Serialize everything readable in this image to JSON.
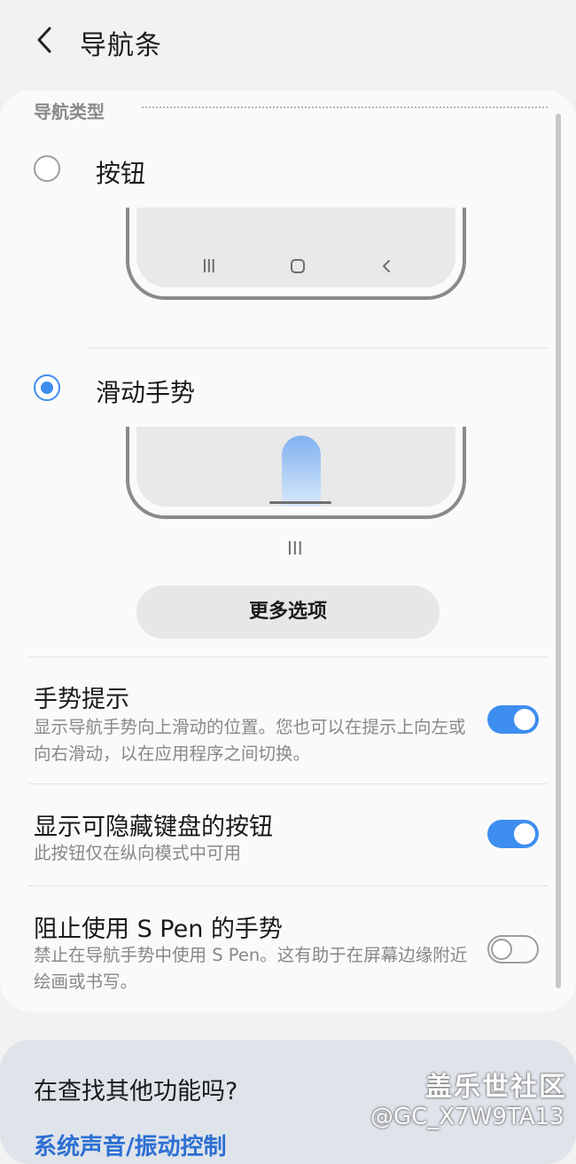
{
  "header": {
    "title": "导航条"
  },
  "nav_type": {
    "section_label": "导航类型",
    "options": [
      {
        "label": "按钮",
        "selected": false
      },
      {
        "label": "滑动手势",
        "selected": true
      }
    ],
    "button_preview_icons": [
      "III",
      "O",
      "<"
    ],
    "gesture_preview_indicator": "III",
    "more_options_label": "更多选项"
  },
  "settings": [
    {
      "title": "手势提示",
      "description": "显示导航手势向上滑动的位置。您也可以在提示上向左或向右滑动，以在应用程序之间切换。",
      "enabled": true
    },
    {
      "title": "显示可隐藏键盘的按钮",
      "description": "此按钮仅在纵向模式中可用",
      "enabled": true
    },
    {
      "title": "阻止使用 S Pen 的手势",
      "description": "禁止在导航手势中使用 S Pen。这有助于在屏幕边缘附近绘画或书写。",
      "enabled": false
    }
  ],
  "footer": {
    "question": "在查找其他功能吗?",
    "link": "系统声音/振动控制"
  },
  "watermark": {
    "brand": "盖乐世社区",
    "user": "@GC_X7W9TA13"
  },
  "colors": {
    "accent": "#3e8ef0",
    "link": "#2d6fd3",
    "background": "#f2f2f2"
  }
}
